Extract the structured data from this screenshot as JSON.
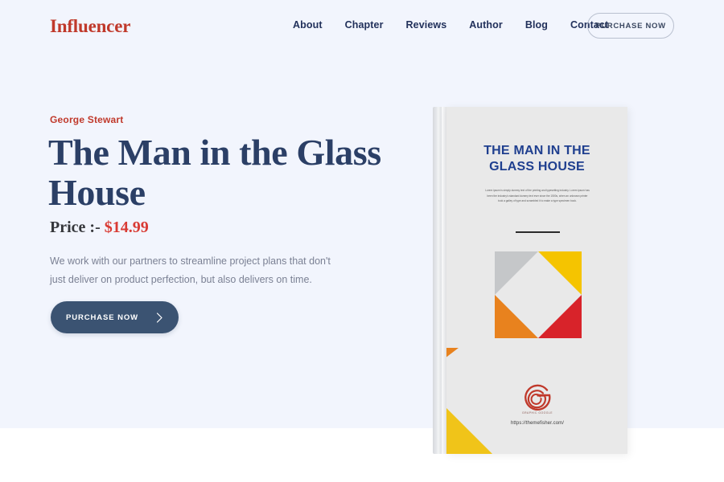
{
  "header": {
    "logo": "Influencer",
    "nav": [
      {
        "label": "About"
      },
      {
        "label": "Chapter"
      },
      {
        "label": "Reviews"
      },
      {
        "label": "Author"
      },
      {
        "label": "Blog"
      },
      {
        "label": "Contact"
      }
    ],
    "cta_label": "PURCHASE NOW"
  },
  "hero": {
    "author": "George Stewart",
    "title": "The Man in the Glass House",
    "price_label": "Price :-",
    "price_value": "$14.99",
    "description": "We work with our partners to streamline project plans that don't just deliver on product perfection, but also delivers on time.",
    "cta_label": "PURCHASE NOW",
    "cta_icon": "chevron-right-icon"
  },
  "book": {
    "cover_title": "THE MAN IN THE GLASS HOUSE",
    "cover_body": "Lorem ipsum is simply dummy text of the printing and typesetting industry. Lorem ipsum has been the industry's standard dummy text ever since the 1500s, when an unknown printer took a galley of type and scrambled it to make a type specimen book.",
    "logo_caption": "GRAPHIC GOOGLE",
    "url": "https://themefisher.com/"
  },
  "colors": {
    "page_background": "#f2f5fd",
    "brand_red": "#c0392b",
    "nav_text": "#22315b",
    "title_navy": "#2b3f66",
    "price_red": "#d93b34",
    "body_gray": "#7b8194",
    "cta_navy": "#3b5372",
    "cover_bg": "#e9e9e9",
    "cover_title_blue": "#1f3f8f",
    "pinwheel_gray": "#c5c7c9",
    "pinwheel_yellow": "#f5c400",
    "pinwheel_orange": "#e8821e",
    "pinwheel_red": "#d8232a"
  }
}
